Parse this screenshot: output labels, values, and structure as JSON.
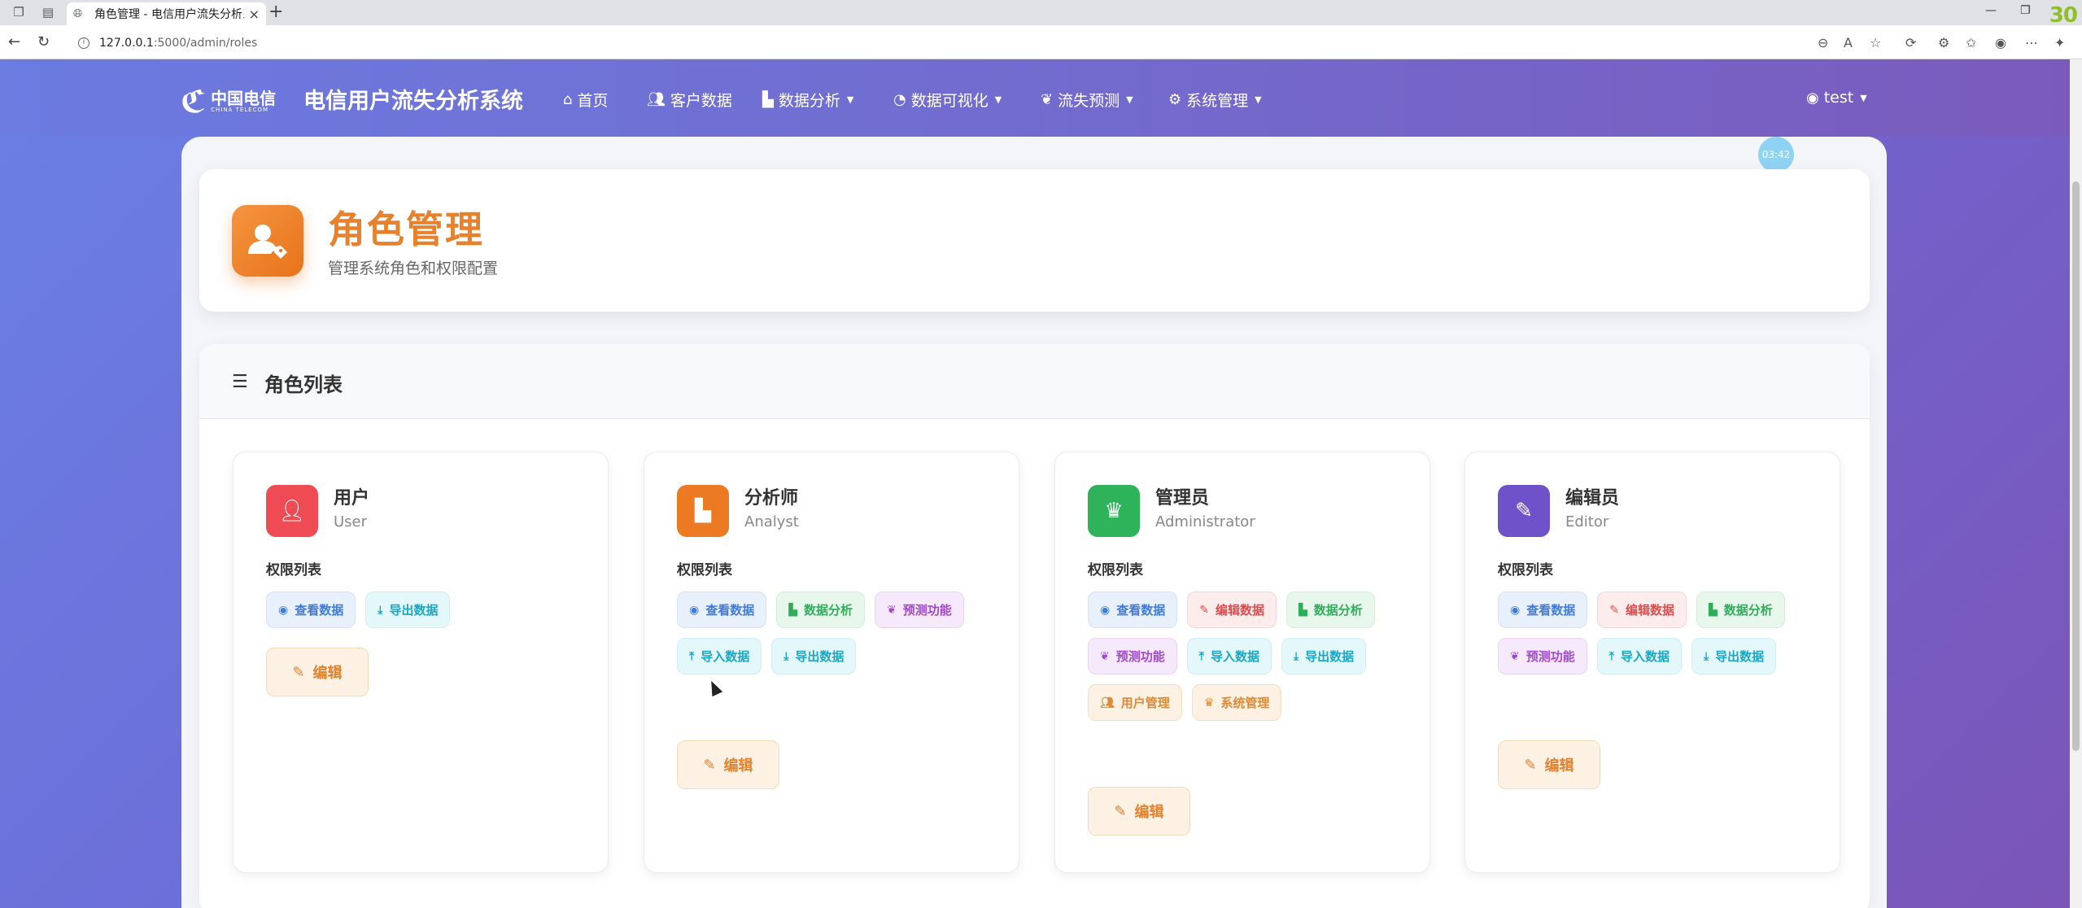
{
  "browser": {
    "tab_title": "角色管理 - 电信用户流失分析系统",
    "url_domain": "127.0.0.1",
    "url_path": ":5000/admin/roles",
    "new_tab": "+",
    "corner_badge": "30"
  },
  "navbar": {
    "logo_cn": "中国电信",
    "logo_en": "CHINA TELECOM",
    "brand": "电信用户流失分析系统",
    "items": [
      {
        "label": "首页",
        "icon": "home-icon"
      },
      {
        "label": "客户数据",
        "icon": "users-icon"
      },
      {
        "label": "数据分析",
        "icon": "chart-bar-icon",
        "dropdown": true
      },
      {
        "label": "数据可视化",
        "icon": "chart-pie-icon",
        "dropdown": true
      },
      {
        "label": "流失预测",
        "icon": "brain-icon",
        "dropdown": true
      },
      {
        "label": "系统管理",
        "icon": "gear-icon",
        "dropdown": true
      }
    ],
    "user": "test"
  },
  "timer": "03:42",
  "header": {
    "title": "角色管理",
    "subtitle": "管理系统角色和权限配置"
  },
  "list": {
    "title": "角色列表"
  },
  "permission_label": "权限列表",
  "edit_label": "编辑",
  "roles": [
    {
      "name": "用户",
      "en": "User",
      "color": "#ee4b55",
      "icon": "user-icon",
      "permissions": [
        {
          "label": "查看数据",
          "style": "blue",
          "icon": "eye-icon"
        },
        {
          "label": "导出数据",
          "style": "cyan",
          "icon": "download-icon"
        }
      ]
    },
    {
      "name": "分析师",
      "en": "Analyst",
      "color": "#ec7a22",
      "icon": "chart-bar-icon",
      "permissions": [
        {
          "label": "查看数据",
          "style": "blue",
          "icon": "eye-icon"
        },
        {
          "label": "数据分析",
          "style": "green",
          "icon": "chart-bar-icon"
        },
        {
          "label": "预测功能",
          "style": "purple",
          "icon": "brain-icon"
        },
        {
          "label": "导入数据",
          "style": "cyan",
          "icon": "upload-icon"
        },
        {
          "label": "导出数据",
          "style": "cyan",
          "icon": "download-icon"
        }
      ]
    },
    {
      "name": "管理员",
      "en": "Administrator",
      "color": "#2fb35a",
      "icon": "crown-icon",
      "permissions": [
        {
          "label": "查看数据",
          "style": "blue",
          "icon": "eye-icon"
        },
        {
          "label": "编辑数据",
          "style": "red",
          "icon": "edit-icon"
        },
        {
          "label": "数据分析",
          "style": "green",
          "icon": "chart-bar-icon"
        },
        {
          "label": "预测功能",
          "style": "purple",
          "icon": "brain-icon"
        },
        {
          "label": "导入数据",
          "style": "cyan",
          "icon": "upload-icon"
        },
        {
          "label": "导出数据",
          "style": "cyan",
          "icon": "download-icon"
        },
        {
          "label": "用户管理",
          "style": "orange",
          "icon": "users-icon"
        },
        {
          "label": "系统管理",
          "style": "orange",
          "icon": "crown-icon"
        }
      ]
    },
    {
      "name": "编辑员",
      "en": "Editor",
      "color": "#6f52c9",
      "icon": "user-edit-icon",
      "permissions": [
        {
          "label": "查看数据",
          "style": "blue",
          "icon": "eye-icon"
        },
        {
          "label": "编辑数据",
          "style": "red",
          "icon": "edit-icon"
        },
        {
          "label": "数据分析",
          "style": "green",
          "icon": "chart-bar-icon"
        },
        {
          "label": "预测功能",
          "style": "purple",
          "icon": "brain-icon"
        },
        {
          "label": "导入数据",
          "style": "cyan",
          "icon": "upload-icon"
        },
        {
          "label": "导出数据",
          "style": "cyan",
          "icon": "download-icon"
        }
      ]
    }
  ]
}
